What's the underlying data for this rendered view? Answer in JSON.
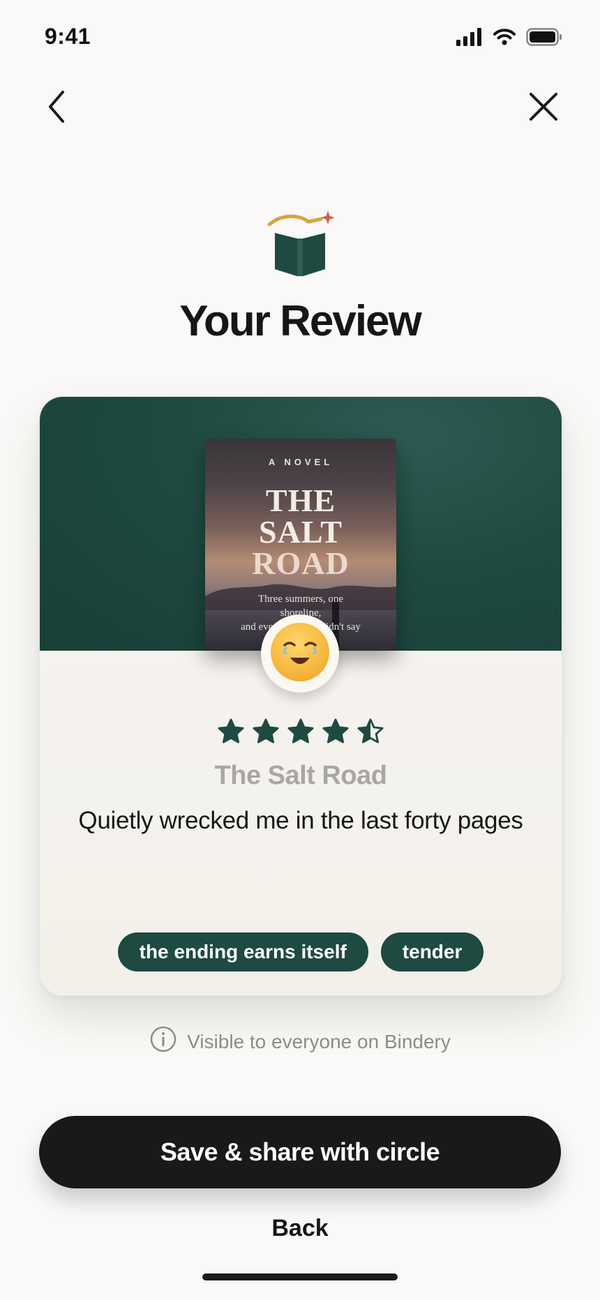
{
  "status_bar": {
    "time": "9:41",
    "icons": [
      "cellular-signal-icon",
      "wifi-icon",
      "battery-icon"
    ]
  },
  "nav": {
    "back_icon": "chevron-left-icon",
    "close_icon": "close-icon"
  },
  "header": {
    "icon": "open-book-sparkle-icon",
    "title": "Your Review"
  },
  "card": {
    "cover": {
      "kicker": "A NOVEL",
      "title_lines": [
        "THE",
        "SALT",
        "ROAD"
      ],
      "tagline_lines": [
        "Three summers, one",
        "shoreline,",
        "and everything we didn't say"
      ]
    },
    "mood": {
      "icon": "relieved-face-emoji-icon"
    },
    "rating": {
      "value": 4.5,
      "max": 5
    },
    "book_title": "The Salt Road",
    "review_text": "Quietly wrecked me in the last forty pages",
    "tags": [
      "the ending earns itself",
      "tender"
    ]
  },
  "visibility": {
    "icon": "info-icon",
    "text": "Visible to everyone on Bindery"
  },
  "actions": {
    "primary_label": "Save & share with circle",
    "secondary_label": "Back"
  },
  "colors": {
    "brand_green": "#1e4a41",
    "accent_gold": "#d9a23a",
    "button_dark": "#181a19"
  }
}
